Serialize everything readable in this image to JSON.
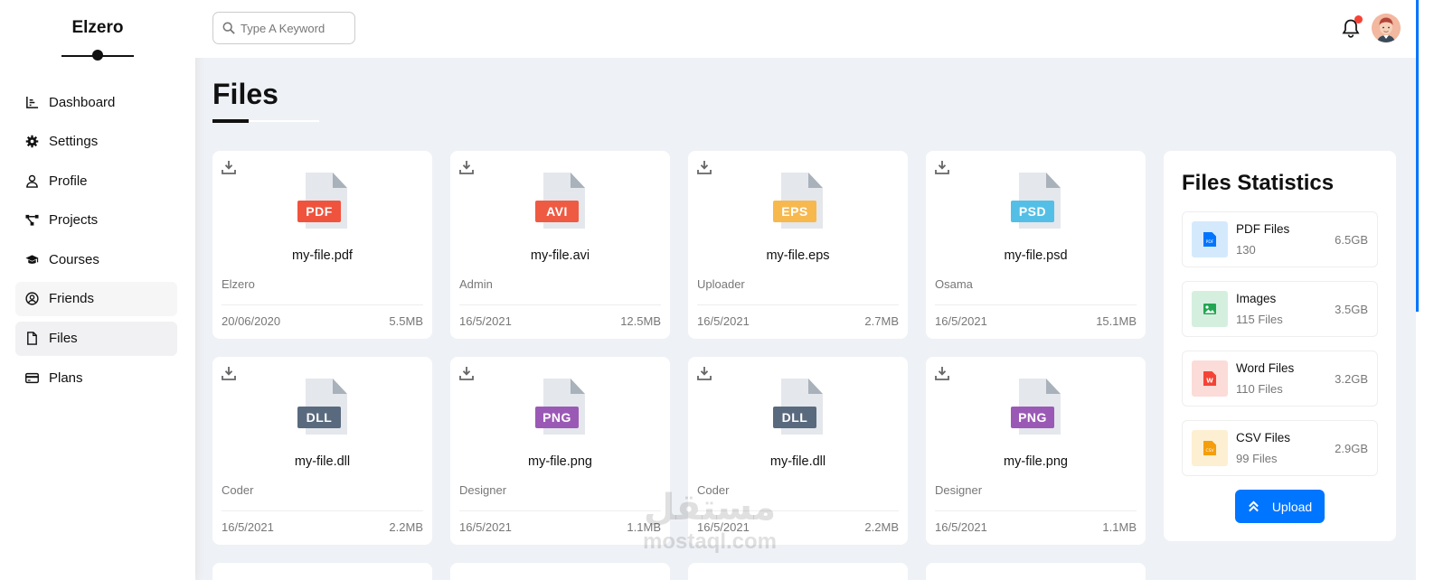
{
  "brand": "Elzero",
  "nav": [
    {
      "label": "Dashboard",
      "icon": "chart-line-icon"
    },
    {
      "label": "Settings",
      "icon": "gear-icon"
    },
    {
      "label": "Profile",
      "icon": "user-icon"
    },
    {
      "label": "Projects",
      "icon": "diagram-project-icon"
    },
    {
      "label": "Courses",
      "icon": "graduation-cap-icon"
    },
    {
      "label": "Friends",
      "icon": "user-circle-icon"
    },
    {
      "label": "Files",
      "icon": "file-icon"
    },
    {
      "label": "Plans",
      "icon": "credit-card-icon"
    }
  ],
  "nav_active": "Files",
  "search": {
    "placeholder": "Type A Keyword"
  },
  "page_title": "Files",
  "files": [
    {
      "name": "my-file.pdf",
      "ext": "PDF",
      "color": "#f0533d",
      "owner": "Elzero",
      "date": "20/06/2020",
      "size": "5.5MB"
    },
    {
      "name": "my-file.avi",
      "ext": "AVI",
      "color": "#ef5a43",
      "owner": "Admin",
      "date": "16/5/2021",
      "size": "12.5MB"
    },
    {
      "name": "my-file.eps",
      "ext": "EPS",
      "color": "#f7b84e",
      "owner": "Uploader",
      "date": "16/5/2021",
      "size": "2.7MB"
    },
    {
      "name": "my-file.psd",
      "ext": "PSD",
      "color": "#54bfe6",
      "owner": "Osama",
      "date": "16/5/2021",
      "size": "15.1MB"
    },
    {
      "name": "my-file.dll",
      "ext": "DLL",
      "color": "#596a7e",
      "owner": "Coder",
      "date": "16/5/2021",
      "size": "2.2MB"
    },
    {
      "name": "my-file.png",
      "ext": "PNG",
      "color": "#9b59b6",
      "owner": "Designer",
      "date": "16/5/2021",
      "size": "1.1MB"
    },
    {
      "name": "my-file.dll",
      "ext": "DLL",
      "color": "#596a7e",
      "owner": "Coder",
      "date": "16/5/2021",
      "size": "2.2MB"
    },
    {
      "name": "my-file.png",
      "ext": "PNG",
      "color": "#9b59b6",
      "owner": "Designer",
      "date": "16/5/2021",
      "size": "1.1MB"
    }
  ],
  "stats": {
    "title": "Files Statistics",
    "items": [
      {
        "name": "PDF Files",
        "count": "130",
        "size": "6.5GB",
        "icon": "file-pdf-icon",
        "bg": "#d5e9fd",
        "fg": "#0075ff"
      },
      {
        "name": "Images",
        "count": "115 Files",
        "size": "3.5GB",
        "icon": "file-image-icon",
        "bg": "#d5efdf",
        "fg": "#22a652"
      },
      {
        "name": "Word Files",
        "count": "110 Files",
        "size": "3.2GB",
        "icon": "file-word-icon",
        "bg": "#fbdcd8",
        "fg": "#f44336"
      },
      {
        "name": "CSV Files",
        "count": "99 Files",
        "size": "2.9GB",
        "icon": "file-csv-icon",
        "bg": "#fdefd2",
        "fg": "#f59e0b"
      }
    ],
    "upload_label": "Upload"
  },
  "watermark": {
    "arabic": "مستقل",
    "latin": "mostaql.com"
  }
}
